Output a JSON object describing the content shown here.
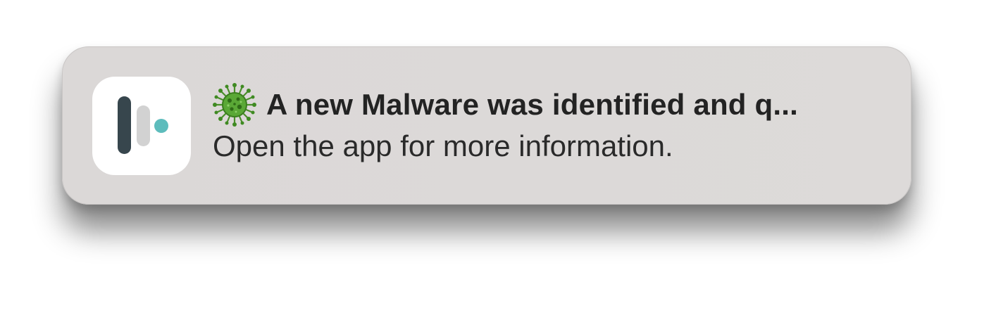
{
  "notification": {
    "app_icon": "app-logo-icon",
    "title_icon": "virus-icon",
    "title": "A new Malware was identified and q...",
    "body": "Open the app for more information."
  },
  "colors": {
    "banner_background": "#dbd8d7",
    "logo_dark_bar": "#37464d",
    "logo_light_bar": "#d2d2d2",
    "logo_dot": "#5dbcbc",
    "virus_green": "#4f9a2e"
  }
}
